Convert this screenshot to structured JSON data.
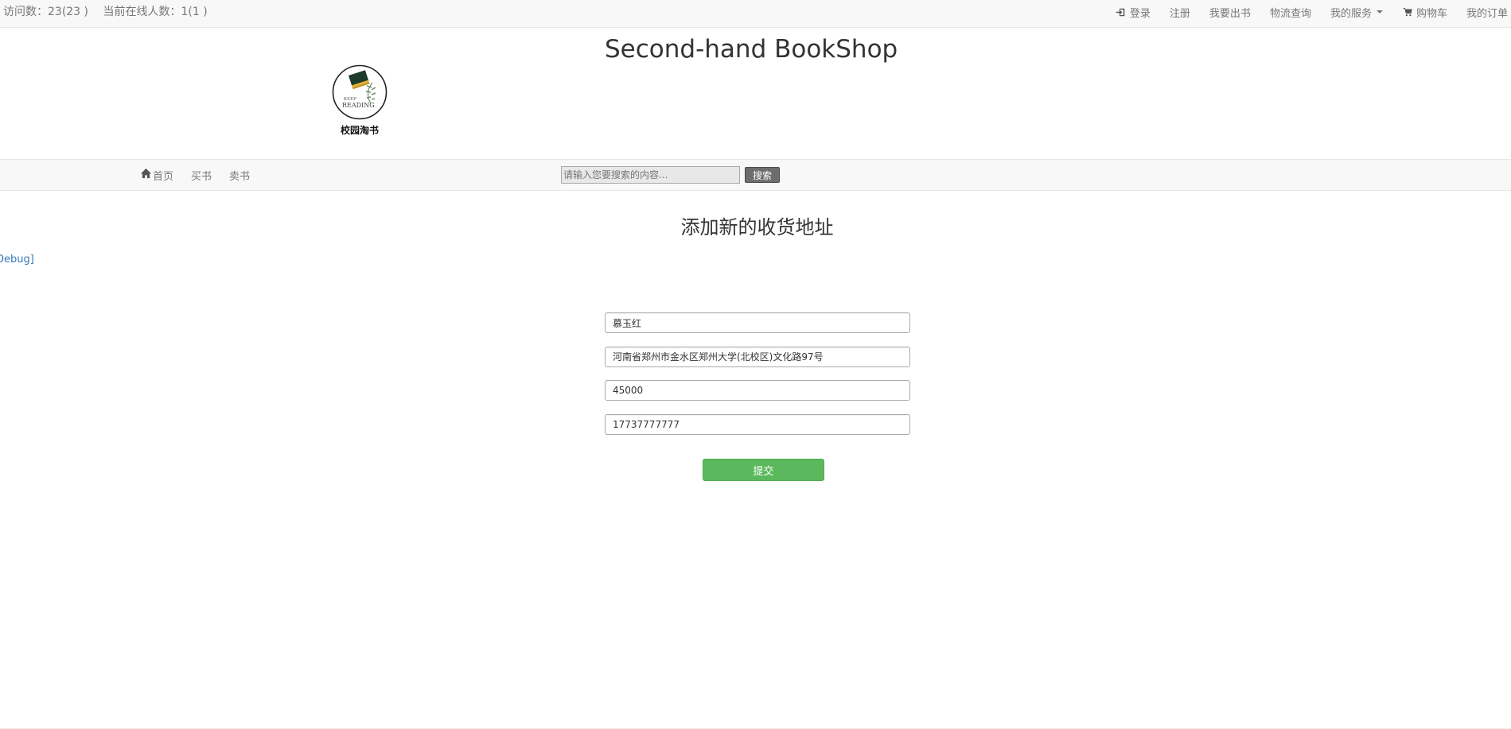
{
  "topbar": {
    "visits": "访问数：23(23 )",
    "online": "当前在线人数：1(1 )",
    "nav": {
      "login": "登录",
      "register": "注册",
      "sell": "我要出书",
      "logistics": "物流查询",
      "services": "我的服务",
      "cart": "购物车",
      "orders": "我的订单"
    }
  },
  "header": {
    "title": "Second-hand BookShop",
    "logo_caption": "校园淘书",
    "logo_text_small": "READING",
    "logo_text_tiny": "KEEP"
  },
  "mainnav": {
    "home": "首页",
    "buy": "买书",
    "sell": "卖书",
    "search_placeholder": "请输入您要搜索的内容...",
    "search_button": "搜索"
  },
  "page": {
    "heading": "添加新的收货地址",
    "debug": "Debug]"
  },
  "form": {
    "name": "慕玉红",
    "address": "河南省郑州市金水区郑州大学(北校区)文化路97号",
    "postcode": "45000",
    "phone": "17737777777",
    "submit": "提交"
  },
  "colors": {
    "submit_bg": "#5cb85c",
    "link": "#337ab7",
    "bar_bg": "#f8f8f8"
  }
}
